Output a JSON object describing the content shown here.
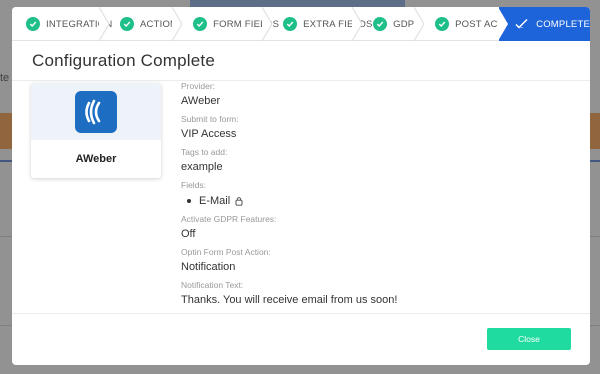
{
  "steps": [
    {
      "label": "INTEGRATION",
      "status": "done"
    },
    {
      "label": "ACTION",
      "status": "done"
    },
    {
      "label": "FORM FIELDS",
      "status": "done"
    },
    {
      "label": "EXTRA FIELDS",
      "status": "done"
    },
    {
      "label": "GDPR",
      "status": "done"
    },
    {
      "label": "POST ACTION",
      "status": "done"
    },
    {
      "label": "COMPLETE",
      "status": "active"
    }
  ],
  "modal": {
    "title": "Configuration Complete",
    "close_label": "Close"
  },
  "provider_card": {
    "name": "AWeber",
    "icon": "aweber-logo-icon"
  },
  "details": {
    "provider_label": "Provider:",
    "provider_value": "AWeber",
    "submit_label": "Submit to form:",
    "submit_value": "VIP Access",
    "tags_label": "Tags to add:",
    "tags_value": "example",
    "fields_label": "Fields:",
    "fields": [
      "E-Mail"
    ],
    "gdpr_label": "Activate GDPR Features:",
    "gdpr_value": "Off",
    "post_action_label": "Optin Form Post Action:",
    "post_action_value": "Notification",
    "notification_label": "Notification Text:",
    "notification_value": "Thanks. You will receive email from us soon!"
  },
  "colors": {
    "accent_blue": "#1d63d9",
    "check_green": "#1fbf8a",
    "close_button": "#1fdba0",
    "logo_blue": "#1d6dc3"
  }
}
